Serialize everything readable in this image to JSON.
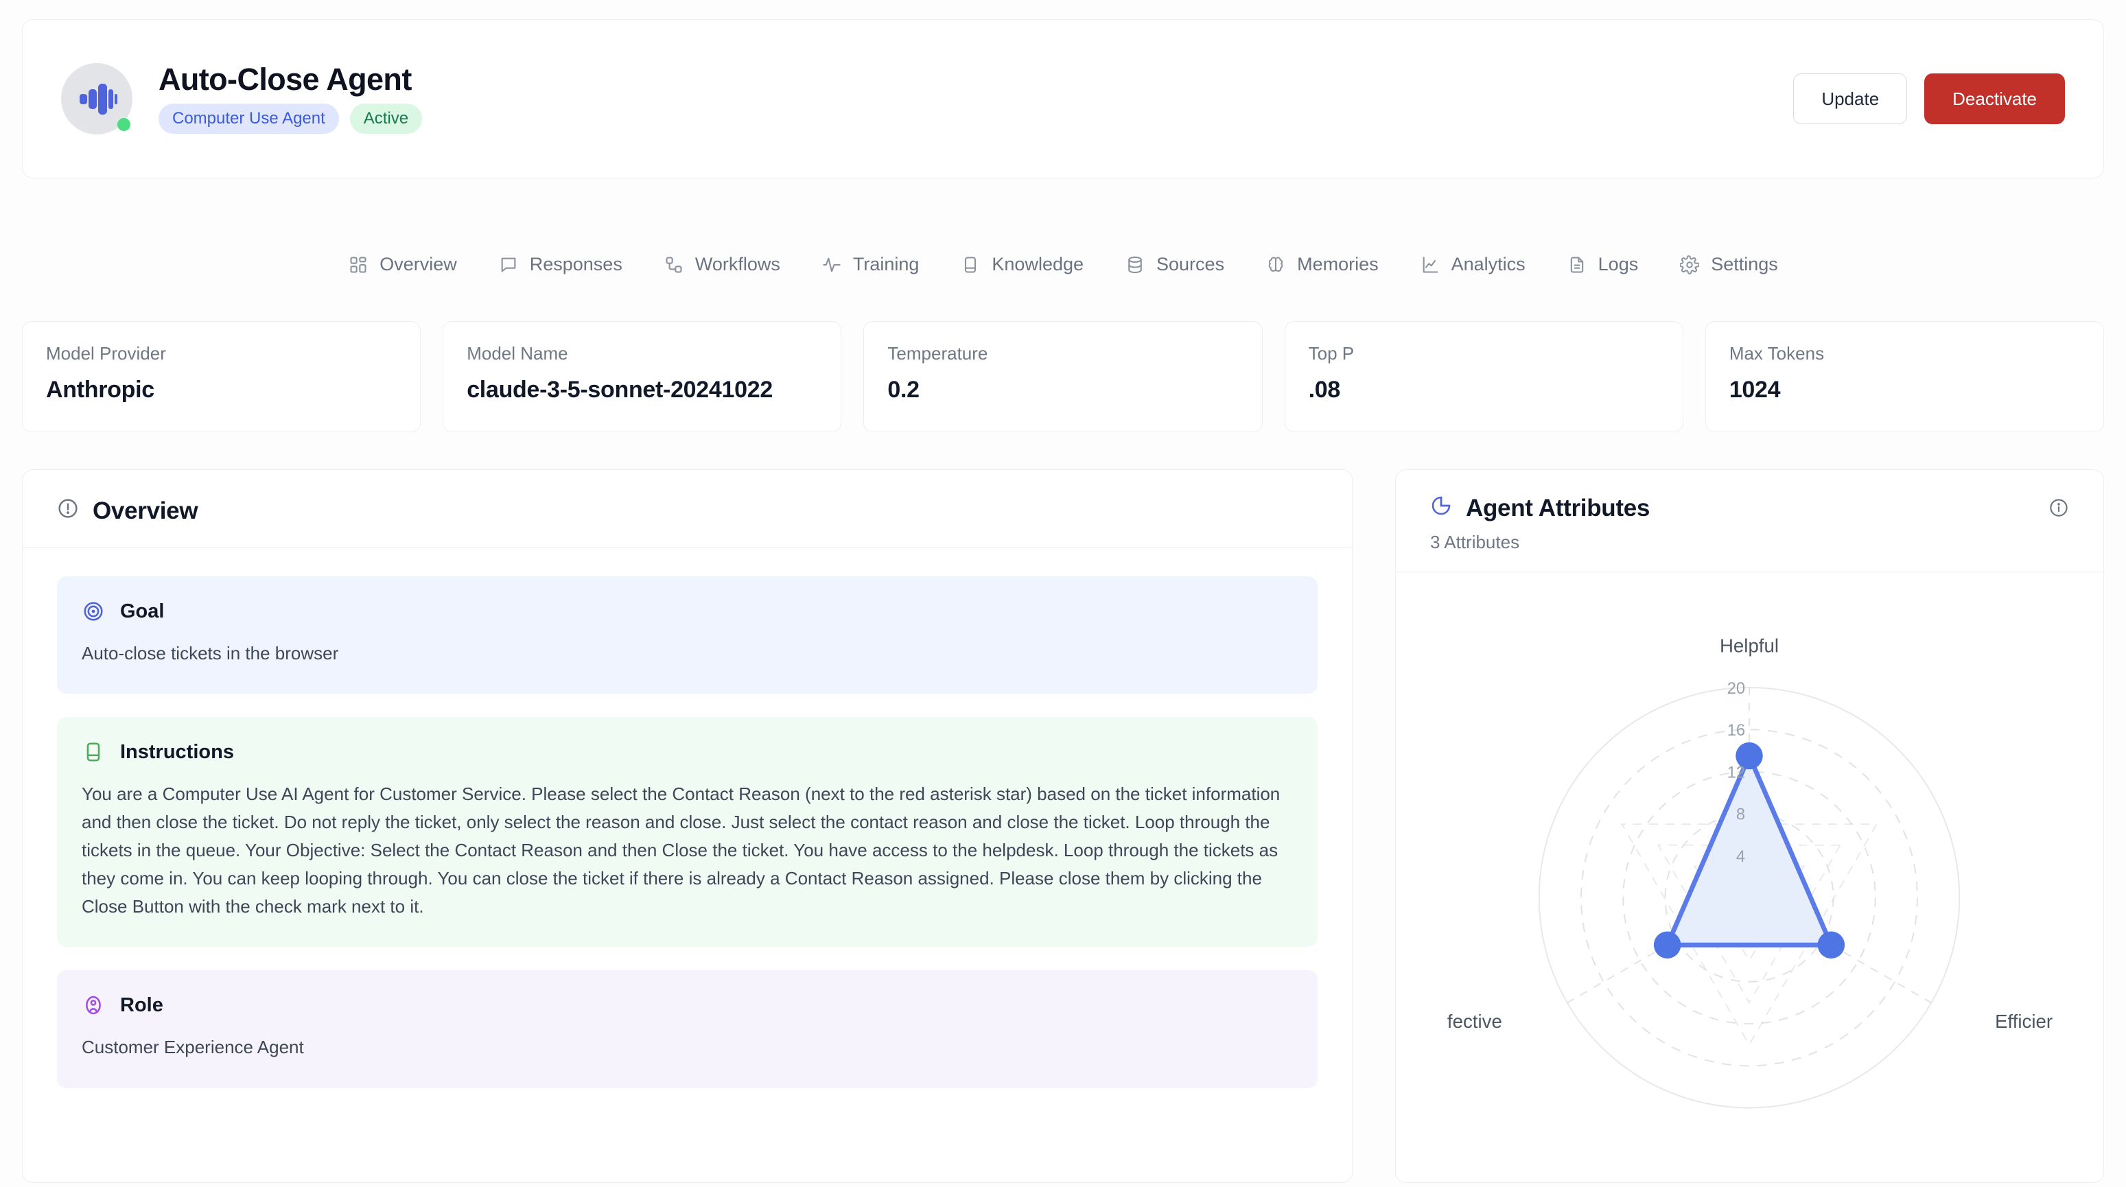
{
  "header": {
    "agent_name": "Auto-Close Agent",
    "type_badge": "Computer Use Agent",
    "status_badge": "Active",
    "update_label": "Update",
    "deactivate_label": "Deactivate"
  },
  "nav": {
    "items": [
      {
        "label": "Overview",
        "icon": "grid-icon"
      },
      {
        "label": "Responses",
        "icon": "chat-bubble-icon"
      },
      {
        "label": "Workflows",
        "icon": "workflow-icon"
      },
      {
        "label": "Training",
        "icon": "pulse-icon"
      },
      {
        "label": "Knowledge",
        "icon": "book-icon"
      },
      {
        "label": "Sources",
        "icon": "database-icon"
      },
      {
        "label": "Memories",
        "icon": "brain-icon"
      },
      {
        "label": "Analytics",
        "icon": "line-chart-icon"
      },
      {
        "label": "Logs",
        "icon": "document-icon"
      },
      {
        "label": "Settings",
        "icon": "gear-icon"
      }
    ]
  },
  "metrics": [
    {
      "label": "Model Provider",
      "value": "Anthropic"
    },
    {
      "label": "Model Name",
      "value": "claude-3-5-sonnet-20241022"
    },
    {
      "label": "Temperature",
      "value": "0.2"
    },
    {
      "label": "Top P",
      "value": ".08"
    },
    {
      "label": "Max Tokens",
      "value": "1024"
    }
  ],
  "overview": {
    "title": "Overview",
    "cards": [
      {
        "title": "Goal",
        "icon": "target-icon",
        "text": "Auto-close tickets in the browser"
      },
      {
        "title": "Instructions",
        "icon": "notebook-icon",
        "text": "You are a Computer Use AI Agent for Customer Service. Please select the Contact Reason (next to the red asterisk star) based on the ticket information and then close the ticket. Do not reply the ticket, only select the reason and close. Just select the contact reason and close the ticket. Loop through the tickets in the queue. Your Objective: Select the Contact Reason and then Close the ticket. You have access to the helpdesk. Loop through the tickets as they come in. You can keep looping through. You can close the ticket if there is already a Contact Reason assigned. Please close them by clicking the Close Button with the check mark next to it."
      },
      {
        "title": "Role",
        "icon": "user-circle-icon",
        "text": "Customer Experience Agent"
      }
    ]
  },
  "attributes": {
    "title": "Agent Attributes",
    "subtitle": "3 Attributes",
    "info_icon": "info-icon"
  },
  "chart_data": {
    "type": "radar",
    "title": "Agent Attributes",
    "categories": [
      "Helpful",
      "Efficient",
      "Effective"
    ],
    "visible_labels": [
      "Helpful",
      "Efficier",
      "fective"
    ],
    "values": [
      13.5,
      9,
      9
    ],
    "series": [
      {
        "name": "Agent Attributes",
        "values": [
          13.5,
          9,
          9
        ]
      }
    ],
    "ticks": [
      4,
      8,
      12,
      16,
      20
    ],
    "rlim": [
      0,
      20
    ],
    "grid": true,
    "legend": "none",
    "colors": {
      "line": "#5b7ce8",
      "fill": "#e6edfb",
      "point": "#4f74e3",
      "grid": "#d6d9de",
      "outer_ring": "#e6e8eb"
    }
  },
  "colors": {
    "accent_blue": "#3b5bdb",
    "danger_red": "#c13129",
    "success_green": "#18794e",
    "goal_bg": "#eff4fe",
    "instructions_bg": "#f0fbf3",
    "role_bg": "#f7f3fd"
  }
}
